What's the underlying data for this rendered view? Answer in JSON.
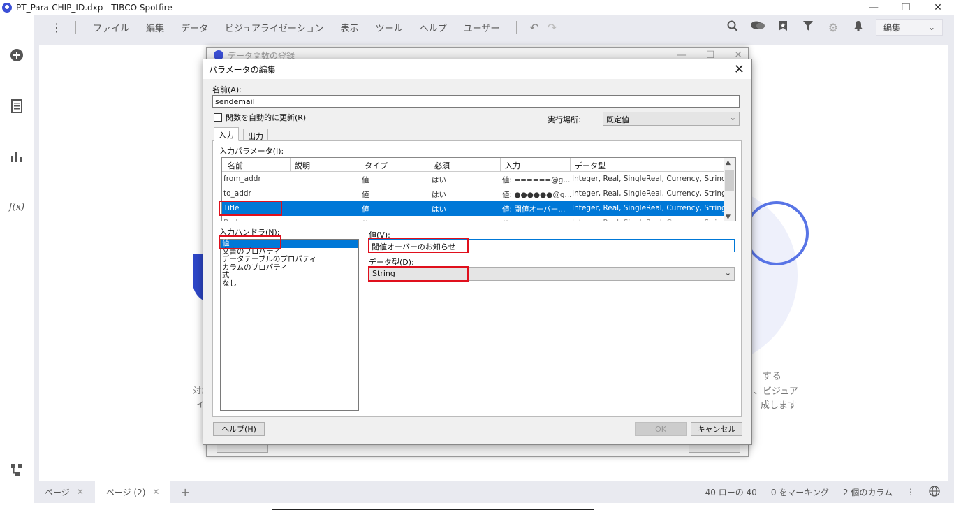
{
  "window": {
    "title": "PT_Para-CHIP_ID.dxp - TIBCO Spotfire",
    "minimize": "—",
    "restore": "❐",
    "close": "✕"
  },
  "menu": {
    "items": [
      "ファイル",
      "編集",
      "データ",
      "ビジュアライゼーション",
      "表示",
      "ツール",
      "ヘルプ",
      "ユーザー"
    ],
    "mode_select": "編集"
  },
  "left_rail": {
    "icons": [
      "add-icon",
      "data-table-icon",
      "visualization-icon",
      "function-icon",
      "flow-icon"
    ],
    "function_label": "f(x)"
  },
  "canvas_bg_text": {
    "right_line1": "する",
    "right_line2": "、ビジュア",
    "right_line3": "成します",
    "left_line1": "対象",
    "left_line2": "イ"
  },
  "bg_dialog": {
    "title": "データ関数の登録"
  },
  "dialog": {
    "title": "パラメータの編集",
    "close": "✕",
    "name_label": "名前(A):",
    "name_value": "sendemail",
    "auto_refresh_label": "関数を自動的に更新(R)",
    "auto_refresh_checked": false,
    "exec_location_label": "実行場所:",
    "exec_location_value": "既定値",
    "tabs": [
      "入力",
      "出力"
    ],
    "active_tab": "入力",
    "input_params_label": "入力パラメータ(I):",
    "grid": {
      "columns": [
        "名前",
        "説明",
        "タイプ",
        "必須",
        "入力",
        "データ型"
      ],
      "rows": [
        {
          "name": "from_addr",
          "desc": "",
          "type": "値",
          "required": "はい",
          "input": "値: ======@g...",
          "datatype": "Integer, Real, SingleReal, Currency, String,..."
        },
        {
          "name": "to_addr",
          "desc": "",
          "type": "値",
          "required": "はい",
          "input": "値: ●●●●●●@g...",
          "datatype": "Integer, Real, SingleReal, Currency, String,..."
        },
        {
          "name": "Title",
          "desc": "",
          "type": "値",
          "required": "はい",
          "input": "値: 閾値オーバー...",
          "datatype": "Integer, Real, SingleReal, Currency, String,..."
        },
        {
          "name": "Body",
          "desc": "",
          "type": "値",
          "required": "はい",
          "input": "値: ...",
          "datatype": "Integer, Real, SingleReal, Currency, String,..."
        }
      ],
      "selected_row": 2
    },
    "input_handler_label": "入力ハンドラ(N):",
    "input_handlers": [
      "値",
      "文書のプロパティ",
      "データテーブルのプロパティ",
      "カラムのプロパティ",
      "式",
      "なし"
    ],
    "selected_handler": 0,
    "value_label": "値(V):",
    "value_value": "閾値オーバーのお知らせ|",
    "datatype_label": "データ型(D):",
    "datatype_value": "String",
    "help_button": "ヘルプ(H)",
    "ok_button": "OK",
    "cancel_button": "キャンセル"
  },
  "statusbar": {
    "tabs": [
      "ページ",
      "ページ (2)"
    ],
    "active_tab": 1,
    "add": "+",
    "rows": "40 ローの 40",
    "marking": "0 をマーキング",
    "columns": "2 個のカラム"
  }
}
